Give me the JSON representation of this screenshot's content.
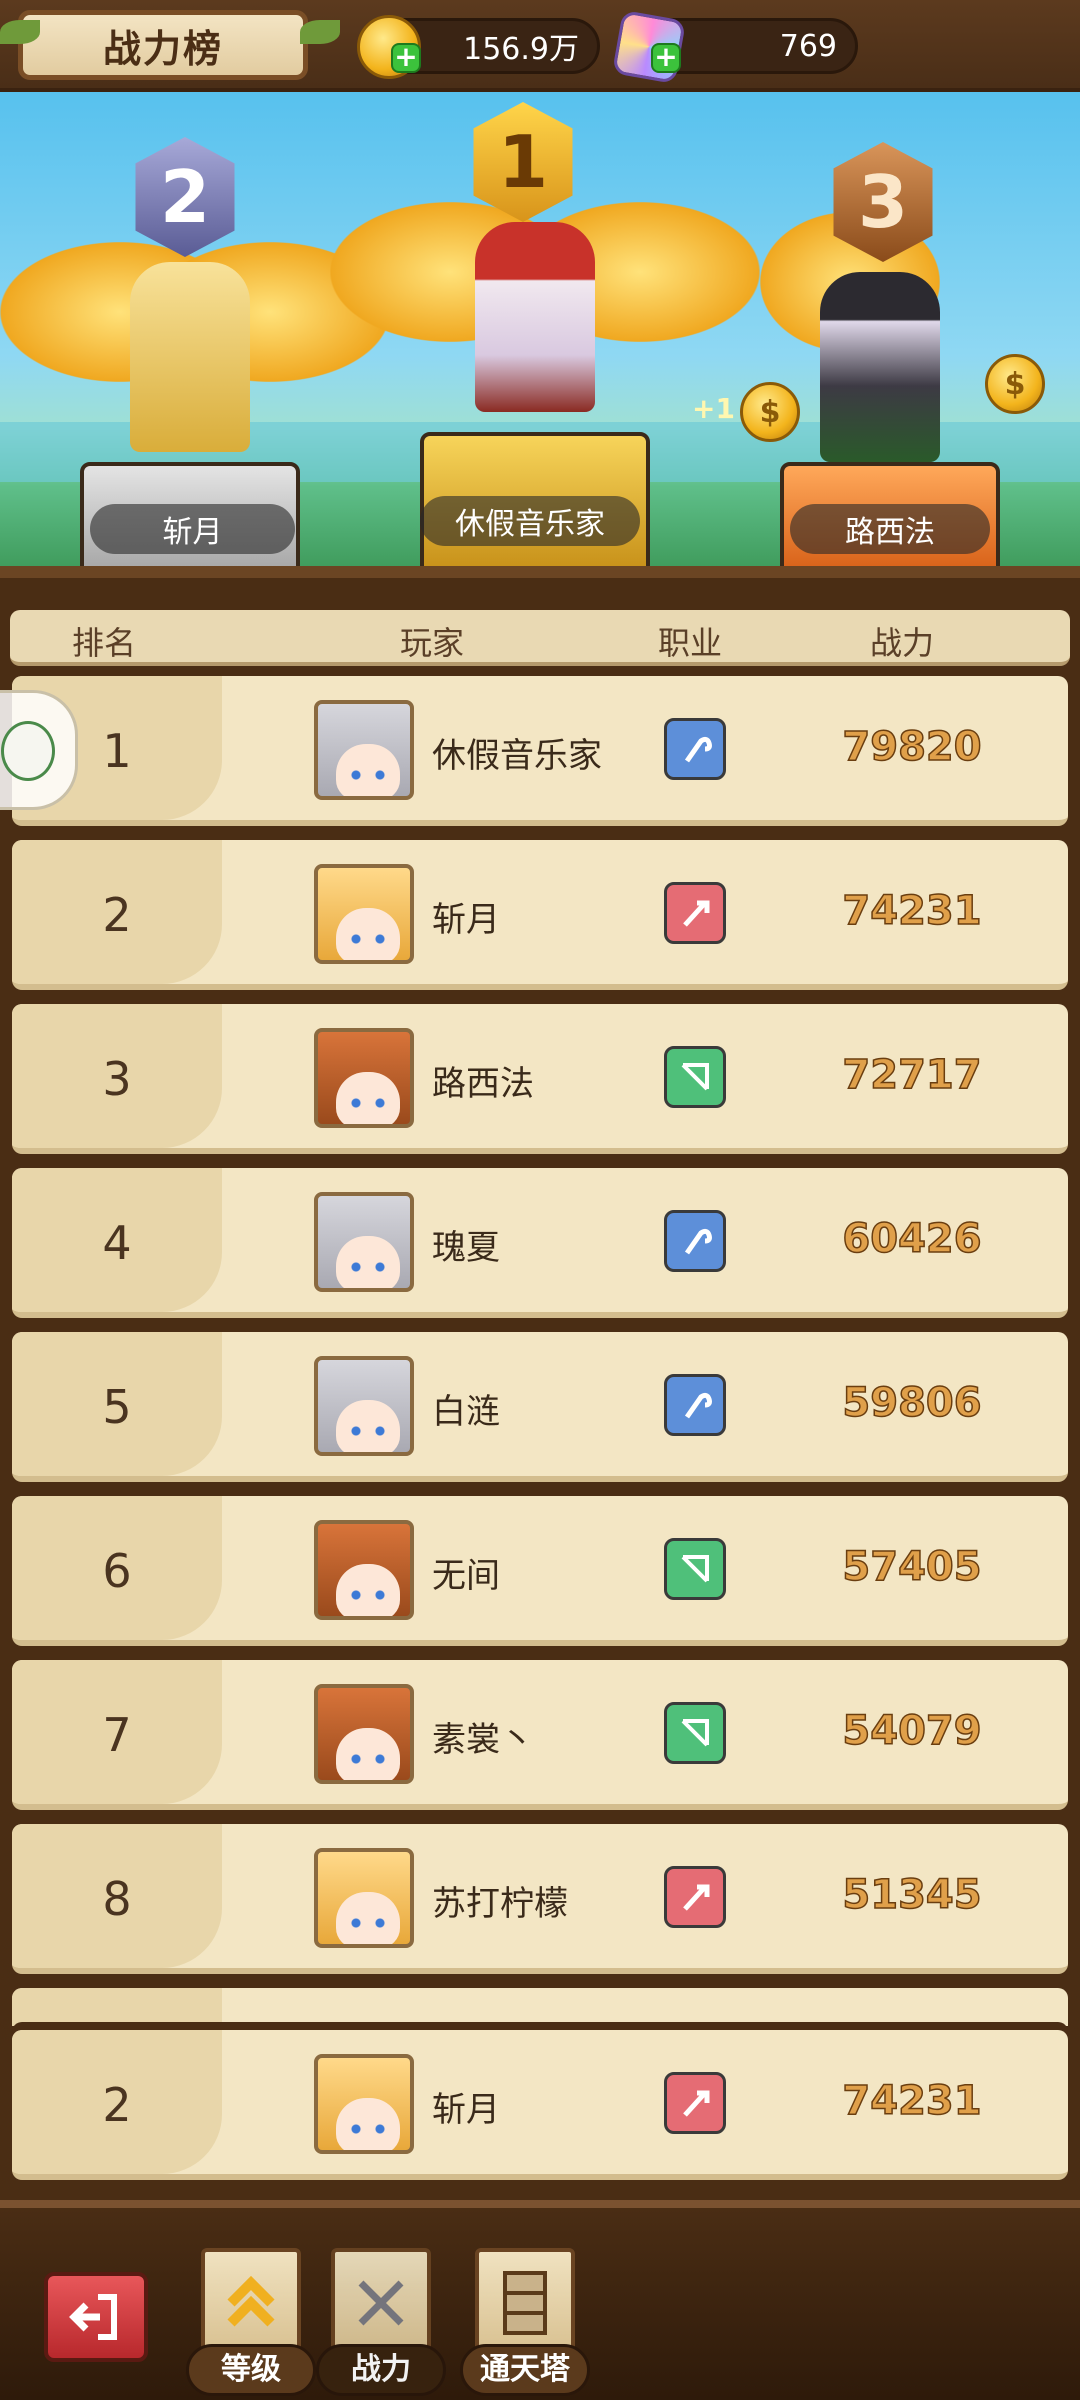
{
  "header": {
    "title": "战力榜",
    "gold": "156.9万",
    "gems": "769",
    "gold_icon": "gold-coin-icon",
    "gem_icon": "crystal-gem-icon"
  },
  "podium": {
    "first": {
      "rank": "1",
      "name": "休假音乐家"
    },
    "second": {
      "rank": "2",
      "name": "斩月"
    },
    "third": {
      "rank": "3",
      "name": "路西法"
    },
    "coin_bonus": "+1"
  },
  "columns": {
    "rank": "排名",
    "player": "玩家",
    "class": "职业",
    "power": "战力"
  },
  "rows": [
    {
      "rank": "1",
      "name": "休假音乐家",
      "cls": "mage",
      "power": "79820"
    },
    {
      "rank": "2",
      "name": "斩月",
      "cls": "warrior",
      "power": "74231"
    },
    {
      "rank": "3",
      "name": "路西法",
      "cls": "archer",
      "power": "72717"
    },
    {
      "rank": "4",
      "name": "瑰夏",
      "cls": "mage",
      "power": "60426"
    },
    {
      "rank": "5",
      "name": "白涟",
      "cls": "mage",
      "power": "59806"
    },
    {
      "rank": "6",
      "name": "无间",
      "cls": "archer",
      "power": "57405"
    },
    {
      "rank": "7",
      "name": "素裳丶",
      "cls": "archer",
      "power": "54079"
    },
    {
      "rank": "8",
      "name": "苏打柠檬",
      "cls": "warrior",
      "power": "51345"
    }
  ],
  "my_rank": {
    "rank": "2",
    "name": "斩月",
    "cls": "warrior",
    "power": "74231"
  },
  "nav": {
    "back_icon": "exit-arrow-icon",
    "tabs": [
      {
        "label": "等级",
        "icon": "level-up-arrow-icon"
      },
      {
        "label": "战力",
        "icon": "crossed-swords-icon"
      },
      {
        "label": "通天塔",
        "icon": "tower-icon"
      }
    ],
    "active_tab": "战力"
  },
  "colors": {
    "mage": "#5d8fd9",
    "warrior": "#e56c74",
    "archer": "#4fc07a",
    "power_text": "#e0a04a"
  }
}
